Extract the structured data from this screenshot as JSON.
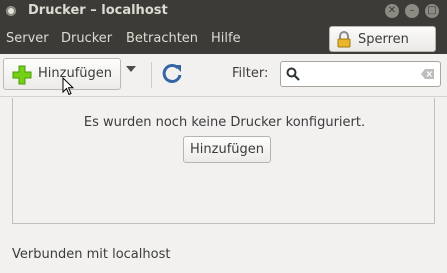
{
  "window": {
    "title": "Drucker – localhost",
    "buttons": [
      "close-icon",
      "minimize-icon",
      "maximize-icon"
    ]
  },
  "menubar": {
    "items": [
      "Server",
      "Drucker",
      "Betrachten",
      "Hilfe"
    ],
    "lock_button": {
      "label": "Sperren",
      "icon": "lock-icon"
    }
  },
  "toolbar": {
    "add_label": "Hinzufügen",
    "add_icon": "plus-icon",
    "refresh_icon": "refresh-icon",
    "filter_label": "Filter:",
    "filter_value": "",
    "filter_placeholder": ""
  },
  "content": {
    "empty_message": "Es wurden noch keine Drucker konfiguriert.",
    "add_button_label": "Hinzufügen"
  },
  "status": {
    "text": "Verbunden mit localhost"
  },
  "colors": {
    "titlebar": "#3c3b37",
    "accent_green": "#4e9a06",
    "refresh_blue": "#3465a4"
  }
}
